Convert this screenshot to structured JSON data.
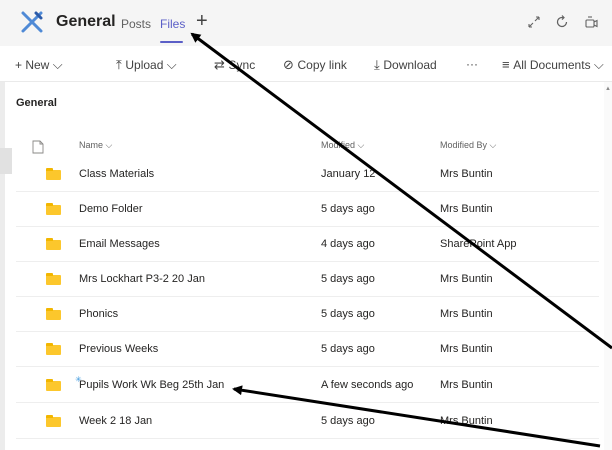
{
  "header": {
    "channel": "General",
    "tabs": [
      {
        "label": "Posts",
        "active": false
      },
      {
        "label": "Files",
        "active": true
      }
    ],
    "add_tab_glyph": "+",
    "icons": [
      "teams-app-icon",
      "expand-icon",
      "refresh-icon",
      "meet-icon"
    ]
  },
  "toolbar": {
    "new_label": "+ New",
    "upload_label": "Upload",
    "sync_label": "Sync",
    "copy_link_label": "Copy link",
    "download_label": "Download",
    "more_label": "···",
    "view_label": "All Documents"
  },
  "section": {
    "title": "General"
  },
  "columns": {
    "name": "Name ⌵",
    "modified": "Modified ⌵",
    "modified_by": "Modified By ⌵"
  },
  "rows": [
    {
      "name": "Class Materials",
      "modified": "January 12",
      "modified_by": "Mrs Buntin"
    },
    {
      "name": "Demo Folder",
      "modified": "5 days ago",
      "modified_by": "Mrs Buntin"
    },
    {
      "name": "Email Messages",
      "modified": "4 days ago",
      "modified_by": "SharePoint App"
    },
    {
      "name": "Mrs Lockhart P3-2 20 Jan",
      "modified": "5 days ago",
      "modified_by": "Mrs Buntin"
    },
    {
      "name": "Phonics",
      "modified": "5 days ago",
      "modified_by": "Mrs Buntin"
    },
    {
      "name": "Previous Weeks",
      "modified": "5 days ago",
      "modified_by": "Mrs Buntin"
    },
    {
      "name": "Pupils Work Wk Beg 25th Jan",
      "modified": "A few seconds ago",
      "modified_by": "Mrs Buntin",
      "new": true
    },
    {
      "name": "Week 2 18 Jan",
      "modified": "5 days ago",
      "modified_by": "Mrs Buntin"
    }
  ],
  "colors": {
    "accent": "#5b5fc7",
    "folder": "#fcc72c",
    "annotation_arrow": "#000000"
  }
}
